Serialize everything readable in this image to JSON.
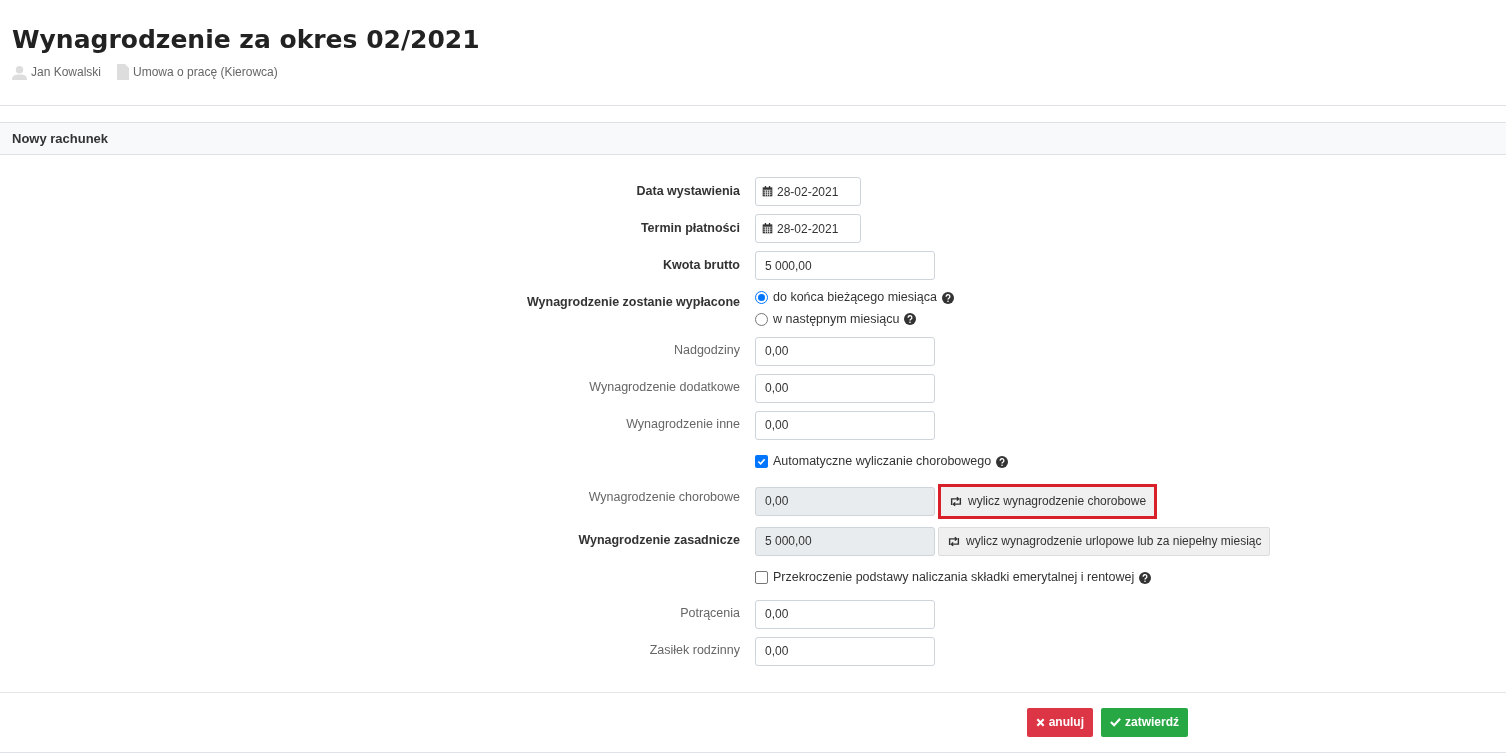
{
  "page": {
    "title": "Wynagrodzenie za okres 02/2021",
    "employee": "Jan Kowalski",
    "contract": "Umowa o pracę (Kierowca)"
  },
  "section": {
    "title": "Nowy rachunek"
  },
  "fields": [
    {
      "kind": "date",
      "label": "Data wystawienia",
      "bold": true,
      "value": "28-02-2021"
    },
    {
      "kind": "date",
      "label": "Termin płatności",
      "bold": true,
      "value": "28-02-2021"
    },
    {
      "kind": "input",
      "label": "Kwota brutto",
      "bold": true,
      "value": "5 000,00"
    },
    {
      "kind": "radio",
      "label": "Wynagrodzenie zostanie wypłacone",
      "bold": true,
      "options": [
        {
          "label": "do końca bieżącego miesiąca",
          "selected": true
        },
        {
          "label": "w następnym miesiącu",
          "selected": false
        }
      ]
    },
    {
      "kind": "input",
      "label": "Nadgodziny",
      "bold": false,
      "value": "0,00"
    },
    {
      "kind": "input",
      "label": "Wynagrodzenie dodatkowe",
      "bold": false,
      "value": "0,00"
    },
    {
      "kind": "input",
      "label": "Wynagrodzenie inne",
      "bold": false,
      "value": "0,00"
    },
    {
      "kind": "checkbox",
      "label": "Automatyczne wyliczanie chorobowego",
      "checked": true
    },
    {
      "kind": "readonly",
      "label": "Wynagrodzenie chorobowe",
      "bold": false,
      "value": "0,00",
      "button": "wylicz wynagrodzenie chorobowe",
      "highlighted": true
    },
    {
      "kind": "readonly",
      "label": "Wynagrodzenie zasadnicze",
      "bold": true,
      "value": "5 000,00",
      "button": "wylicz wynagrodzenie urlopowe lub za niepełny miesiąc",
      "highlighted": false
    },
    {
      "kind": "checkbox",
      "label": "Przekroczenie podstawy naliczania składki emerytalnej i rentowej",
      "checked": false
    },
    {
      "kind": "input",
      "label": "Potrącenia",
      "bold": false,
      "value": "0,00"
    },
    {
      "kind": "input",
      "label": "Zasiłek rodzinny",
      "bold": false,
      "value": "0,00"
    }
  ],
  "actions": {
    "cancel": "anuluj",
    "confirm": "zatwierdź"
  }
}
